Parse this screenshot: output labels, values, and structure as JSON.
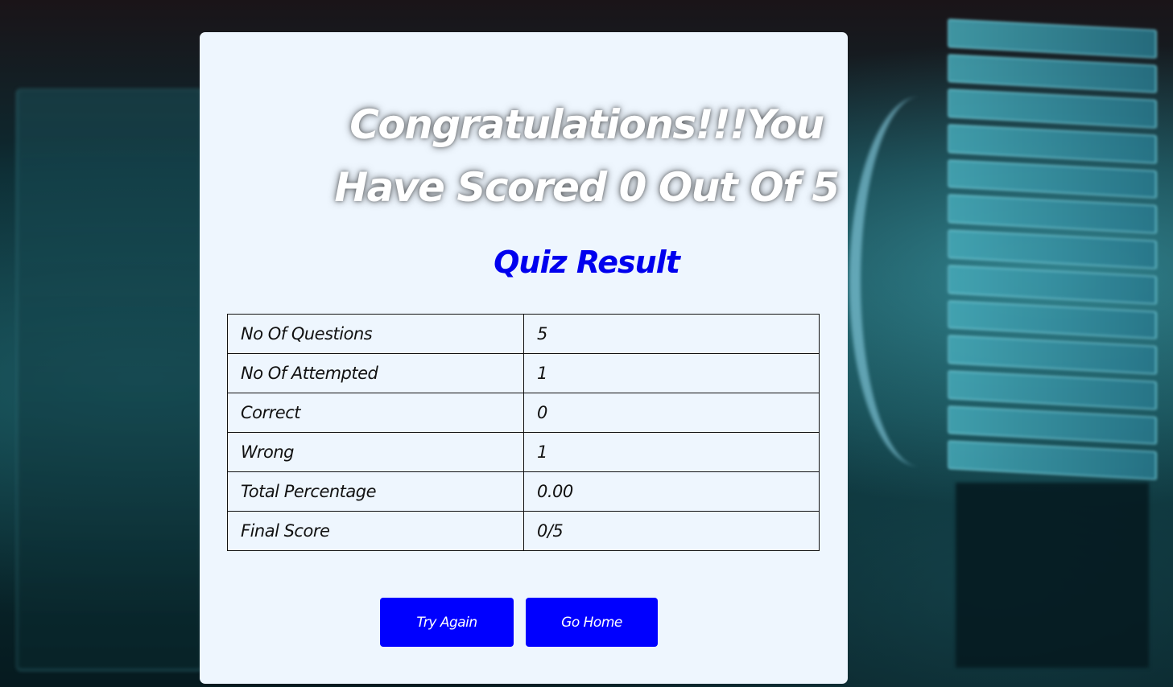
{
  "result": {
    "headline": "Congratulations!!!You Have Scored 0 Out Of 5",
    "subtitle": "Quiz Result"
  },
  "table": {
    "rows": [
      {
        "label": "No Of Questions",
        "value": "5"
      },
      {
        "label": "No Of Attempted",
        "value": "1"
      },
      {
        "label": "Correct",
        "value": "0"
      },
      {
        "label": "Wrong",
        "value": "1"
      },
      {
        "label": "Total Percentage",
        "value": "0.00"
      },
      {
        "label": "Final Score",
        "value": "0/5"
      }
    ]
  },
  "buttons": {
    "try_again": "Try Again",
    "go_home": "Go Home"
  },
  "colors": {
    "accent": "#0000ff",
    "card_background": "#eef6fe",
    "subtitle": "#0000ee"
  }
}
